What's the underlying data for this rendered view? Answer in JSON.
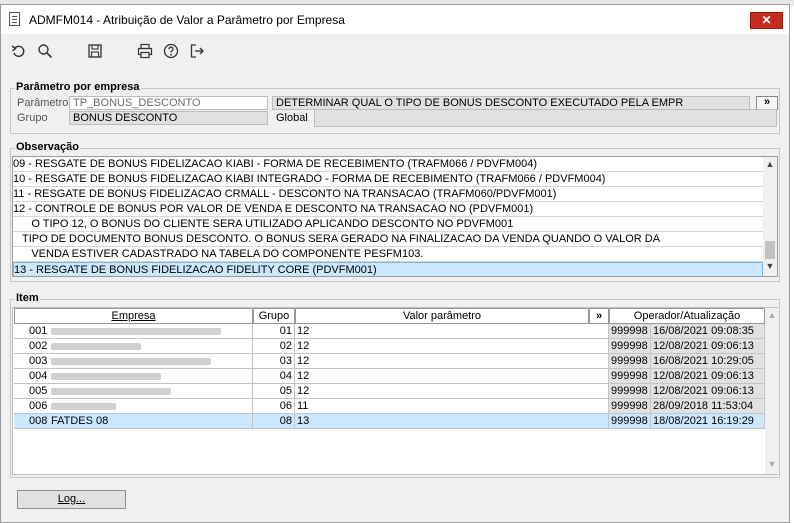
{
  "window": {
    "title": "ADMFM014 - Atribuição de Valor a Parâmetro por Empresa",
    "close_glyph": "✕"
  },
  "toolbar": {
    "icons": [
      "undo-icon",
      "search-icon",
      "save-icon",
      "print-icon",
      "help-icon",
      "exit-icon"
    ]
  },
  "param": {
    "legend": "Parâmetro por empresa",
    "parametro_label": "Parâmetro",
    "parametro_value": "TP_BONUS_DESCONTO",
    "descricao_value": "DETERMINAR QUAL O TIPO DE BONUS DESCONTO EXECUTADO PELA EMPR",
    "more_label": "»",
    "grupo_label": "Grupo",
    "grupo_value": "BONUS DESCONTO",
    "global_label": "Global",
    "global_value": ""
  },
  "observacao": {
    "legend": "Observação",
    "lines": [
      "09 - RESGATE DE BONUS FIDELIZACAO KIABI - FORMA DE RECEBIMENTO (TRAFM066 / PDVFM004)",
      "10 - RESGATE DE BONUS FIDELIZACAO KIABI INTEGRADO - FORMA DE RECEBIMENTO (TRAFM066 / PDVFM004)",
      "11 - RESGATE DE BONUS FIDELIZACAO CRMALL - DESCONTO NA TRANSACAO (TRAFM060/PDVFM001)",
      "12 - CONTROLE DE BONUS POR VALOR DE VENDA E DESCONTO NA TRANSACAO NO (PDVFM001)",
      "      O TIPO 12, O BONUS DO CLIENTE SERA UTILIZADO APLICANDO DESCONTO NO PDVFM001",
      "   TIPO DE DOCUMENTO BONUS DESCONTO. O BONUS SERA GERADO NA FINALIZACAO DA VENDA QUANDO O VALOR DA",
      "      VENDA ESTIVER CADASTRADO NA TABELA DO COMPONENTE PESFM103.",
      "13 - RESGATE DE BONUS FIDELIZACAO FIDELITY CORE (PDVFM001)"
    ],
    "selected_index": 7,
    "scroll_up": "▲",
    "scroll_down": "▼"
  },
  "item": {
    "legend": "Item",
    "headers": {
      "empresa": "Empresa",
      "grupo": "Grupo",
      "valor": "Valor parâmetro",
      "more": "»",
      "operador": "Operador/Atualização"
    },
    "rows": [
      {
        "code": "001",
        "name": "",
        "grupo": "01",
        "valor": "12",
        "operador": "999998",
        "data": "16/08/2021 09:08:35"
      },
      {
        "code": "002",
        "name": "",
        "grupo": "02",
        "valor": "12",
        "operador": "999998",
        "data": "12/08/2021 09:06:13"
      },
      {
        "code": "003",
        "name": "",
        "grupo": "03",
        "valor": "12",
        "operador": "999998",
        "data": "16/08/2021 10:29:05"
      },
      {
        "code": "004",
        "name": "",
        "grupo": "04",
        "valor": "12",
        "operador": "999998",
        "data": "12/08/2021 09:06:13"
      },
      {
        "code": "005",
        "name": "",
        "grupo": "05",
        "valor": "12",
        "operador": "999998",
        "data": "12/08/2021 09:06:13"
      },
      {
        "code": "006",
        "name": "",
        "grupo": "06",
        "valor": "11",
        "operador": "999998",
        "data": "28/09/2018 11:53:04"
      },
      {
        "code": "008",
        "name": "FATDES 08",
        "grupo": "08",
        "valor": "13",
        "operador": "999998",
        "data": "18/08/2021 16:19:29"
      }
    ],
    "selected_index": 6,
    "scroll_up": "▲",
    "scroll_down": "▼"
  },
  "footer": {
    "log_label": "Log..."
  }
}
